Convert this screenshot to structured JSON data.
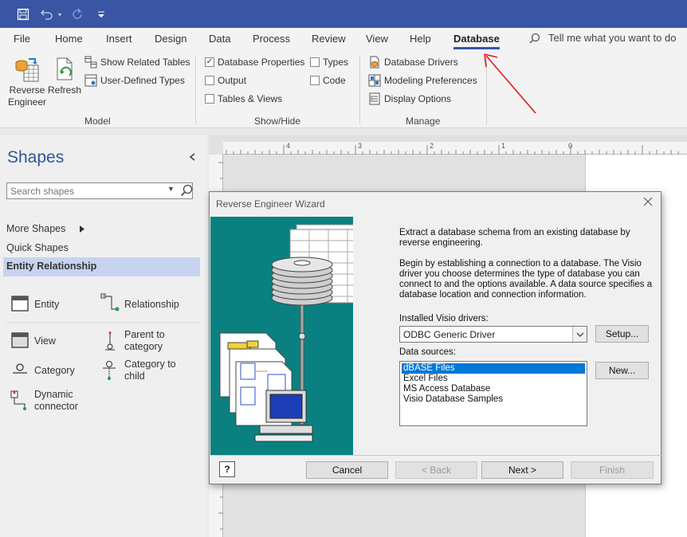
{
  "menu_tabs": [
    "File",
    "Home",
    "Insert",
    "Design",
    "Data",
    "Process",
    "Review",
    "View",
    "Help",
    "Database"
  ],
  "tell_me": "Tell me what you want to do",
  "ribbon": {
    "model": {
      "label": "Model",
      "reverse_engineer": [
        "Reverse",
        "Engineer"
      ],
      "refresh": "Refresh",
      "show_related_tables": "Show Related Tables",
      "user_defined_types": "User-Defined Types"
    },
    "show_hide": {
      "label": "Show/Hide",
      "database_properties": "Database Properties",
      "types": "Types",
      "output": "Output",
      "code": "Code",
      "tables_views": "Tables & Views"
    },
    "manage": {
      "label": "Manage",
      "database_drivers": "Database Drivers",
      "modeling_preferences": "Modeling Preferences",
      "display_options": "Display Options"
    }
  },
  "shapes": {
    "title": "Shapes",
    "search_placeholder": "Search shapes",
    "more_shapes": "More Shapes",
    "quick_shapes": "Quick Shapes",
    "active_stencil": "Entity Relationship",
    "items": {
      "entity": "Entity",
      "relationship": "Relationship",
      "view": "View",
      "parent_to_category": [
        "Parent to",
        "category"
      ],
      "category": "Category",
      "category_to_child": [
        "Category to",
        "child"
      ],
      "dynamic_connector": [
        "Dynamic",
        "connector"
      ]
    }
  },
  "ruler_labels": [
    "4",
    "3",
    "2",
    "1",
    "0"
  ],
  "wizard": {
    "title": "Reverse Engineer Wizard",
    "intro": "Extract a database schema from an existing database by reverse engineering.",
    "description": "Begin by establishing a connection to a database.  The Visio driver you choose determines the type of database you can connect to and the options available.  A data source specifies a database location and connection information.",
    "drivers_label": "Installed Visio drivers:",
    "driver_value": "ODBC Generic Driver",
    "sources_label": "Data sources:",
    "data_sources": [
      "dBASE Files",
      "Excel Files",
      "MS Access Database",
      "Visio Database Samples"
    ],
    "selected_source": "dBASE Files",
    "setup_button": "Setup...",
    "new_button": "New...",
    "cancel_button": "Cancel",
    "back_button": "< Back",
    "next_button": "Next >",
    "finish_button": "Finish",
    "help_glyph": "?"
  },
  "colors": {
    "title_bar": "#3955a3",
    "accent": "#2b579a",
    "selection": "#0078d7",
    "wizard_art_bg": "#0a8180",
    "annotation_arrow": "#e01b24"
  }
}
